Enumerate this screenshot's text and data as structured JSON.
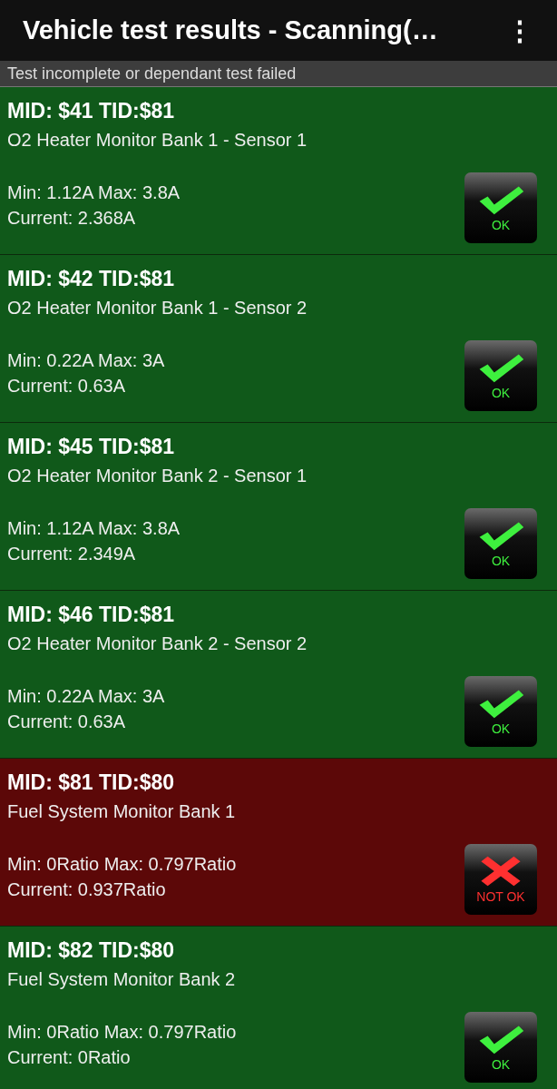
{
  "app_bar": {
    "title": "Vehicle test results - Scanning(…",
    "menu": "⋮"
  },
  "legend": "Test incomplete or dependant test failed",
  "results": [
    {
      "heading": "MID: $41 TID:$81",
      "name": "O2 Heater Monitor Bank 1 - Sensor 1",
      "range": "Min: 1.12A  Max: 3.8A",
      "current": "Current: 2.368A",
      "passed": true,
      "badge": "OK"
    },
    {
      "heading": "MID: $42 TID:$81",
      "name": "O2 Heater Monitor Bank 1 - Sensor 2",
      "range": "Min: 0.22A  Max: 3A",
      "current": "Current: 0.63A",
      "passed": true,
      "badge": "OK"
    },
    {
      "heading": "MID: $45 TID:$81",
      "name": "O2 Heater Monitor Bank 2 - Sensor 1",
      "range": "Min: 1.12A  Max: 3.8A",
      "current": "Current: 2.349A",
      "passed": true,
      "badge": "OK"
    },
    {
      "heading": "MID: $46 TID:$81",
      "name": "O2 Heater Monitor Bank 2 - Sensor 2",
      "range": "Min: 0.22A  Max: 3A",
      "current": "Current: 0.63A",
      "passed": true,
      "badge": "OK"
    },
    {
      "heading": "MID: $81 TID:$80",
      "name": "Fuel System Monitor Bank 1",
      "range": "Min: 0Ratio  Max: 0.797Ratio",
      "current": "Current: 0.937Ratio",
      "passed": false,
      "badge": "NOT OK"
    },
    {
      "heading": "MID: $82 TID:$80",
      "name": "Fuel System Monitor Bank 2",
      "range": "Min: 0Ratio  Max: 0.797Ratio",
      "current": "Current: 0Ratio",
      "passed": true,
      "badge": "OK"
    }
  ]
}
